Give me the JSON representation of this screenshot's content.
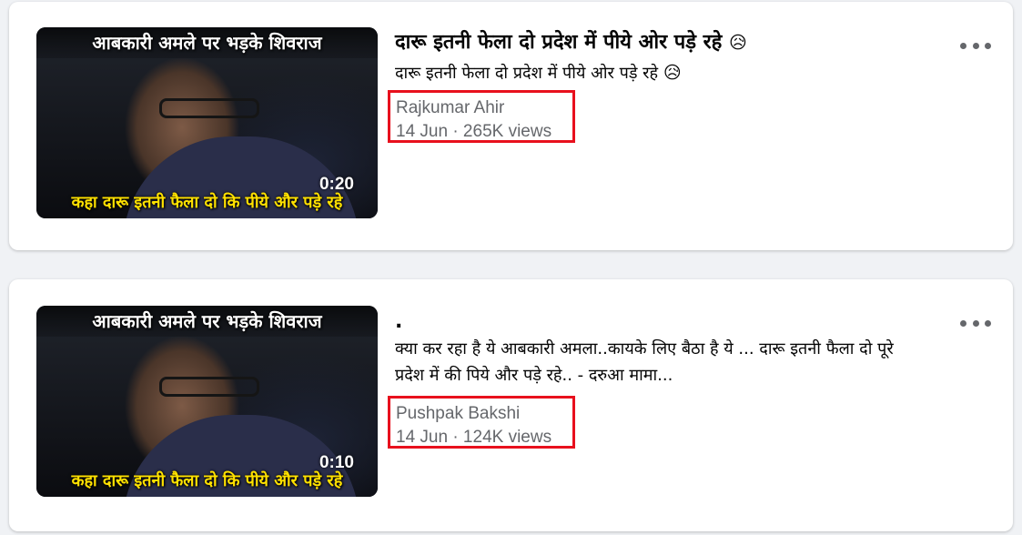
{
  "results": [
    {
      "thumbnail": {
        "top_caption": "आबकारी अमले पर भड़के शिवराज",
        "bottom_caption": "कहा दारू इतनी फैला दो कि पीये और पड़े रहे",
        "duration": "0:20"
      },
      "title": "दारू इतनी फेला दो प्रदेश में पीये ओर पड़े रहे",
      "title_emoji": "😥",
      "description": "दारू इतनी फेला दो प्रदेश में पीये ओर पड़े रहे",
      "description_emoji": "😥",
      "author": "Rajkumar Ahir",
      "meta": "14 Jun · 265K views",
      "highlight_color": "#e8101d"
    },
    {
      "thumbnail": {
        "top_caption": "आबकारी अमले पर भड़के शिवराज",
        "bottom_caption": "कहा दारू इतनी फैला दो कि पीये और पड़े रहे",
        "duration": "0:10"
      },
      "title": ".",
      "description": "क्या कर रहा है ये आबकारी अमला..कायके लिए बैठा है ये ... दारू इतनी फैला दो पूरे प्रदेश में की पिये और पड़े रहे.. - दरुआ मामा...",
      "author": "Pushpak Bakshi",
      "meta": "14 Jun · 124K views",
      "highlight_color": "#e8101d"
    }
  ],
  "icons": {
    "more": "more-horizontal-icon"
  }
}
